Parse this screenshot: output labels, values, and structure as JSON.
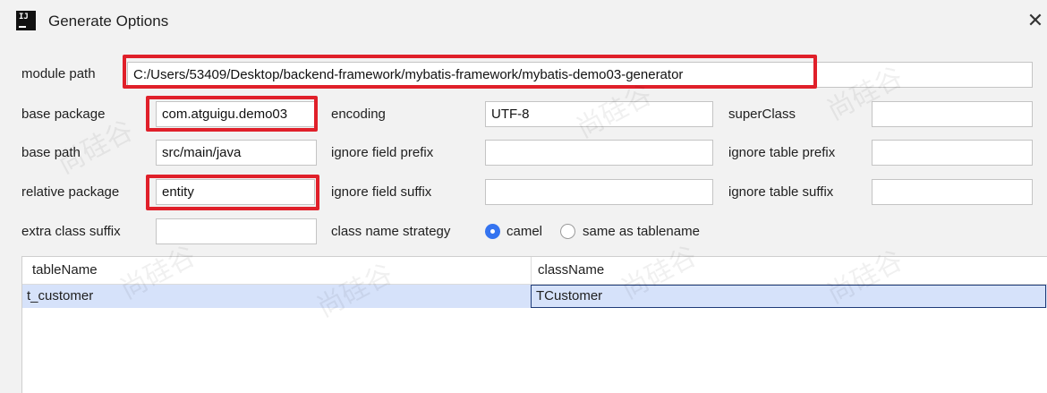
{
  "window": {
    "title": "Generate Options",
    "app_icon_text": "IJ",
    "close_glyph": "✕"
  },
  "form": {
    "module_path": {
      "label": "module path",
      "value": "C:/Users/53409/Desktop/backend-framework/mybatis-framework/mybatis-demo03-generator"
    },
    "base_package": {
      "label": "base package",
      "value": "com.atguigu.demo03"
    },
    "encoding": {
      "label": "encoding",
      "value": "UTF-8"
    },
    "super_class": {
      "label": "superClass",
      "value": ""
    },
    "base_path": {
      "label": "base path",
      "value": "src/main/java"
    },
    "ignore_field_prefix": {
      "label": "ignore field prefix",
      "value": ""
    },
    "ignore_table_prefix": {
      "label": "ignore table prefix",
      "value": ""
    },
    "relative_package": {
      "label": "relative package",
      "value": "entity"
    },
    "ignore_field_suffix": {
      "label": "ignore field suffix",
      "value": ""
    },
    "ignore_table_suffix": {
      "label": "ignore table suffix",
      "value": ""
    },
    "extra_class_suffix": {
      "label": "extra class suffix",
      "value": ""
    },
    "class_name_strategy": {
      "label": "class name strategy",
      "options": [
        {
          "label": "camel",
          "selected": true
        },
        {
          "label": "same as tablename",
          "selected": false
        }
      ]
    }
  },
  "table": {
    "columns": [
      "tableName",
      "className"
    ],
    "rows": [
      {
        "tableName": "t_customer",
        "className": "TCustomer"
      }
    ]
  },
  "watermark_text": "尚硅谷",
  "colors": {
    "highlight": "#e0202a",
    "accent": "#3574f0",
    "selected_row": "#d6e2fa"
  }
}
